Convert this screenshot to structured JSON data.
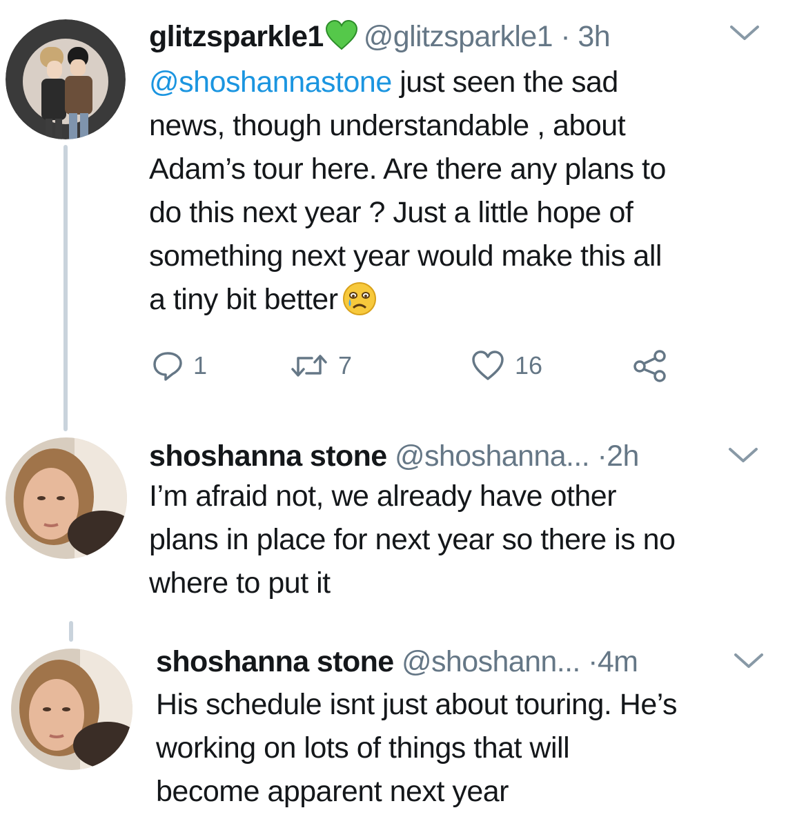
{
  "tweets": [
    {
      "display_name": "glitzsparkle1",
      "badge_icon": "green-heart-icon",
      "handle": "@glitzsparkle1",
      "separator": "·",
      "time": "3h",
      "mention": "@shoshannastone",
      "text_lines": [
        "just seen the sad",
        "news, though understandable , about",
        "Adam’s tour here. Are there any plans to",
        "do this next year ? Just a little hope of",
        "something next year would make this all",
        "a tiny bit better"
      ],
      "emoji_icon": "crying-face-icon",
      "actions": {
        "reply_count": "1",
        "retweet_count": "7",
        "like_count": "16"
      }
    },
    {
      "display_name": "shoshanna stone",
      "handle": "@shoshanna...",
      "separator": "·",
      "time": "2h",
      "text_lines": [
        "I’m afraid not, we already have other",
        "plans in place for next year so there is no",
        "where to put it"
      ]
    },
    {
      "display_name": "shoshanna stone",
      "handle": "@shoshann...",
      "separator": "·",
      "time": "4m",
      "text_lines": [
        "His schedule isnt just about touring. He’s",
        "working on lots of things that will",
        "become apparent next year"
      ]
    }
  ],
  "colors": {
    "link": "#1b95e0",
    "muted": "#657786",
    "text": "#14171a",
    "thread_line": "#c9d3dc",
    "badge_green": "#55c84a"
  }
}
